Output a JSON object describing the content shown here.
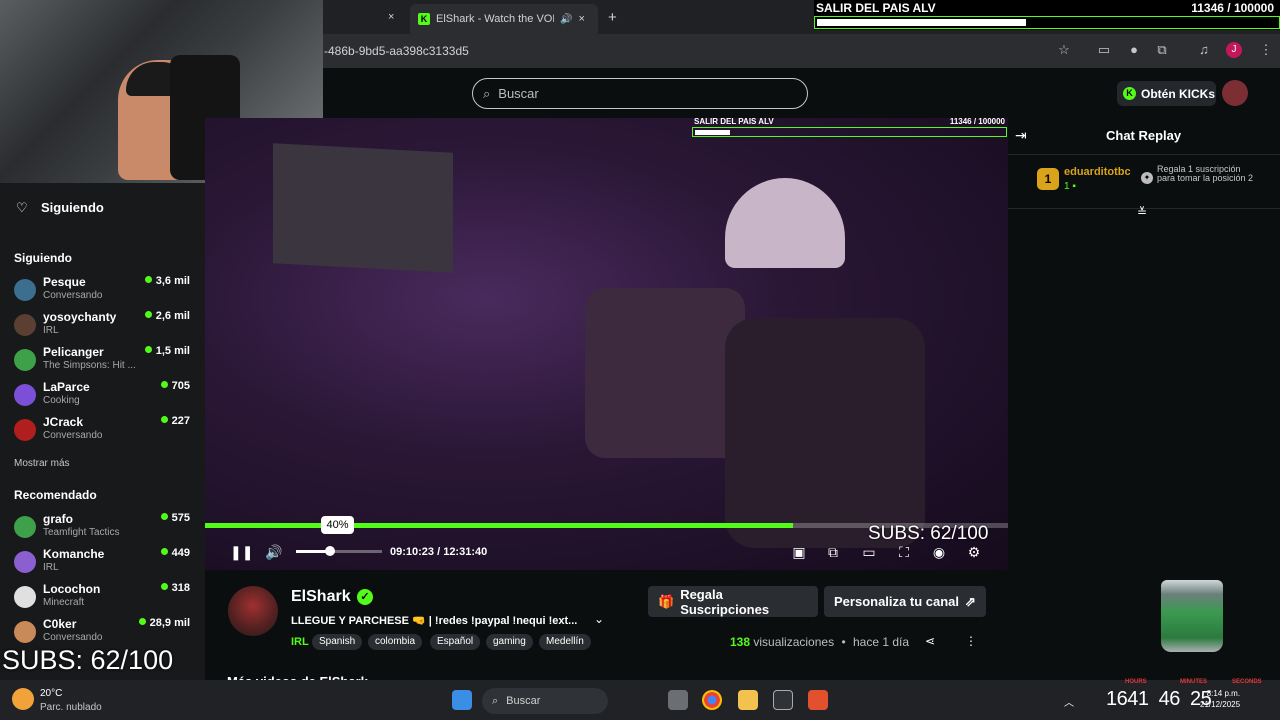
{
  "browser": {
    "tab_label": "ElShark - Watch the VOD on",
    "tab_close": "×",
    "new_tab": "+",
    "url": "-486b-9bd5-aa398c3133d5",
    "profile_initial": "J"
  },
  "overlay_goal": {
    "title": "SALIR DEL PAIS ALV",
    "count": "11346 / 100000",
    "progress": 0.11346
  },
  "header": {
    "search_placeholder": "Buscar",
    "kicks_label": "Obtén KICKs"
  },
  "sidebar": {
    "following_header": "Siguiendo",
    "following_title": "Siguiendo",
    "following": [
      {
        "name": "Pesque",
        "category": "Conversando",
        "viewers": "3,6 mil",
        "color": "#3c6e8f"
      },
      {
        "name": "yosoychanty",
        "category": "IRL",
        "viewers": "2,6 mil",
        "color": "#5a3f32"
      },
      {
        "name": "Pelicanger",
        "category": "The Simpsons: Hit ...",
        "viewers": "1,5 mil",
        "color": "#3fa04a"
      },
      {
        "name": "LaParce",
        "category": "Cooking",
        "viewers": "705",
        "color": "#7b4fd6"
      },
      {
        "name": "JCrack",
        "category": "Conversando",
        "viewers": "227",
        "color": "#b01e1e"
      }
    ],
    "show_more": "Mostrar más",
    "recommended_title": "Recomendado",
    "recommended": [
      {
        "name": "grafo",
        "category": "Teamfight Tactics",
        "viewers": "575",
        "color": "#3fa04a"
      },
      {
        "name": "Komanche",
        "category": "IRL",
        "viewers": "449",
        "color": "#8c5fd1"
      },
      {
        "name": "Locochon",
        "category": "Minecraft",
        "viewers": "318",
        "color": "#e0e0e0"
      },
      {
        "name": "C0ker",
        "category": "Conversando",
        "viewers": "28,9 mil",
        "color": "#c98a5a"
      }
    ]
  },
  "video_goal": {
    "title": "SALIR DEL PAIS ALV",
    "count": "11346 / 100000",
    "progress": 0.11346
  },
  "player": {
    "time": "09:10:23 / 12:31:40",
    "progress": 0.732,
    "volume_tooltip": "40%",
    "volume": 0.4,
    "subs_overlay": "SUBS: 62/100"
  },
  "chat": {
    "title": "Chat Replay",
    "top_gifter": {
      "rank": "1",
      "name": "eduarditotbc",
      "count": "1"
    },
    "gift_text": "Regala 1 suscripción para tomar la posición 2"
  },
  "channel": {
    "name": "ElShark",
    "title": "LLEGUE Y PARCHESE 🤜 | !redes !paypal !nequi !ext...",
    "category": "IRL",
    "tags": [
      "Spanish",
      "colombia",
      "Español",
      "gaming",
      "Medellín"
    ],
    "gift_button": "Regala Suscripciones",
    "customize_button": "Personaliza tu canal",
    "views_count": "138",
    "views_label": "visualizaciones",
    "dot": "•",
    "ago": "hace 1 día",
    "more_videos": "Más videos de ElShark",
    "subs_overlay": "SUBS: 62/100"
  },
  "taskbar": {
    "weather_temp": "20°C",
    "weather_desc": "Parc. nublado",
    "search": "Buscar",
    "timer": "1641  46  25",
    "timer_labels": [
      "HOURS",
      "MINUTES",
      "SECONDS"
    ],
    "clock_time": "8:14 p.m.",
    "clock_date": "21/12/2025"
  }
}
